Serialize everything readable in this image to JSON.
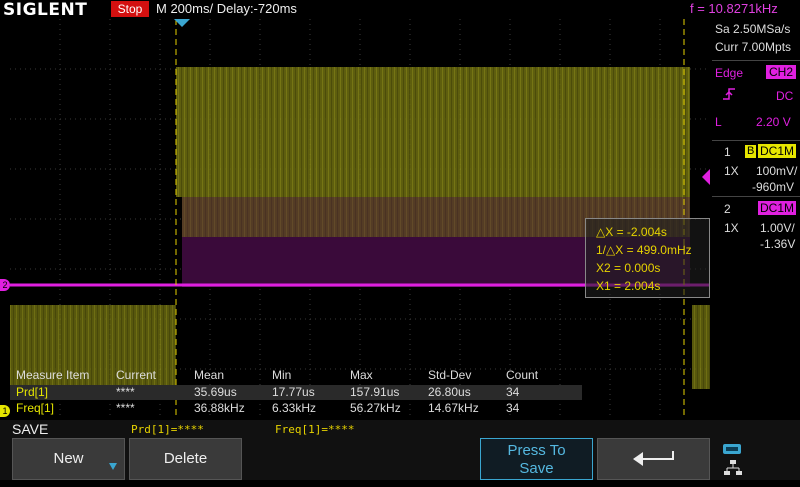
{
  "header": {
    "brand": "SIGLENT",
    "run_state": "Stop",
    "timebase": "M 200ms/",
    "delay": "Delay:-720ms",
    "frequency": "f = 10.8271kHz"
  },
  "acquisition": {
    "sample_rate": "Sa 2.50MSa/s",
    "memory": "Curr 7.00Mpts"
  },
  "trigger": {
    "type": "Edge",
    "source": "CH2",
    "coupling": "DC",
    "level_label": "L",
    "level": "2.20 V"
  },
  "channels": [
    {
      "num": "1",
      "bw": "B",
      "coupling": "DC1M",
      "probe": "1X",
      "scale": "100mV/",
      "offset": "-960mV",
      "color": "#e6e600"
    },
    {
      "num": "2",
      "bw": "",
      "coupling": "DC1M",
      "probe": "1X",
      "scale": "1.00V/",
      "offset": "-1.36V",
      "color": "#e020e0"
    }
  ],
  "cursors": {
    "dx": "△X = -2.004s",
    "inv_dx": "1/△X = 499.0mHz",
    "x2": "X2 = 0.000s",
    "x1": "X1 = 2.004s"
  },
  "markers": {
    "ch1": "1",
    "ch2": "2"
  },
  "measure": {
    "headers": [
      "Measure Item",
      "Current",
      "Mean",
      "Min",
      "Max",
      "Std-Dev",
      "Count"
    ],
    "rows": [
      [
        "Prd[1]",
        "****",
        "35.69us",
        "17.77us",
        "157.91us",
        "26.80us",
        "34"
      ],
      [
        "Freq[1]",
        "****",
        "36.88kHz",
        "6.33kHz",
        "56.27kHz",
        "14.67kHz",
        "34"
      ]
    ]
  },
  "bottom": {
    "menu_title": "SAVE",
    "status_prd": "Prd[1]=****",
    "status_freq": "Freq[1]=****",
    "new_label": "New",
    "delete_label": "Delete",
    "press_line1": "Press To",
    "press_line2": "Save"
  },
  "colors": {
    "ch1": "#e6e600",
    "ch2": "#e020e0",
    "accent": "#3aa6d0",
    "stop": "#d41010"
  }
}
